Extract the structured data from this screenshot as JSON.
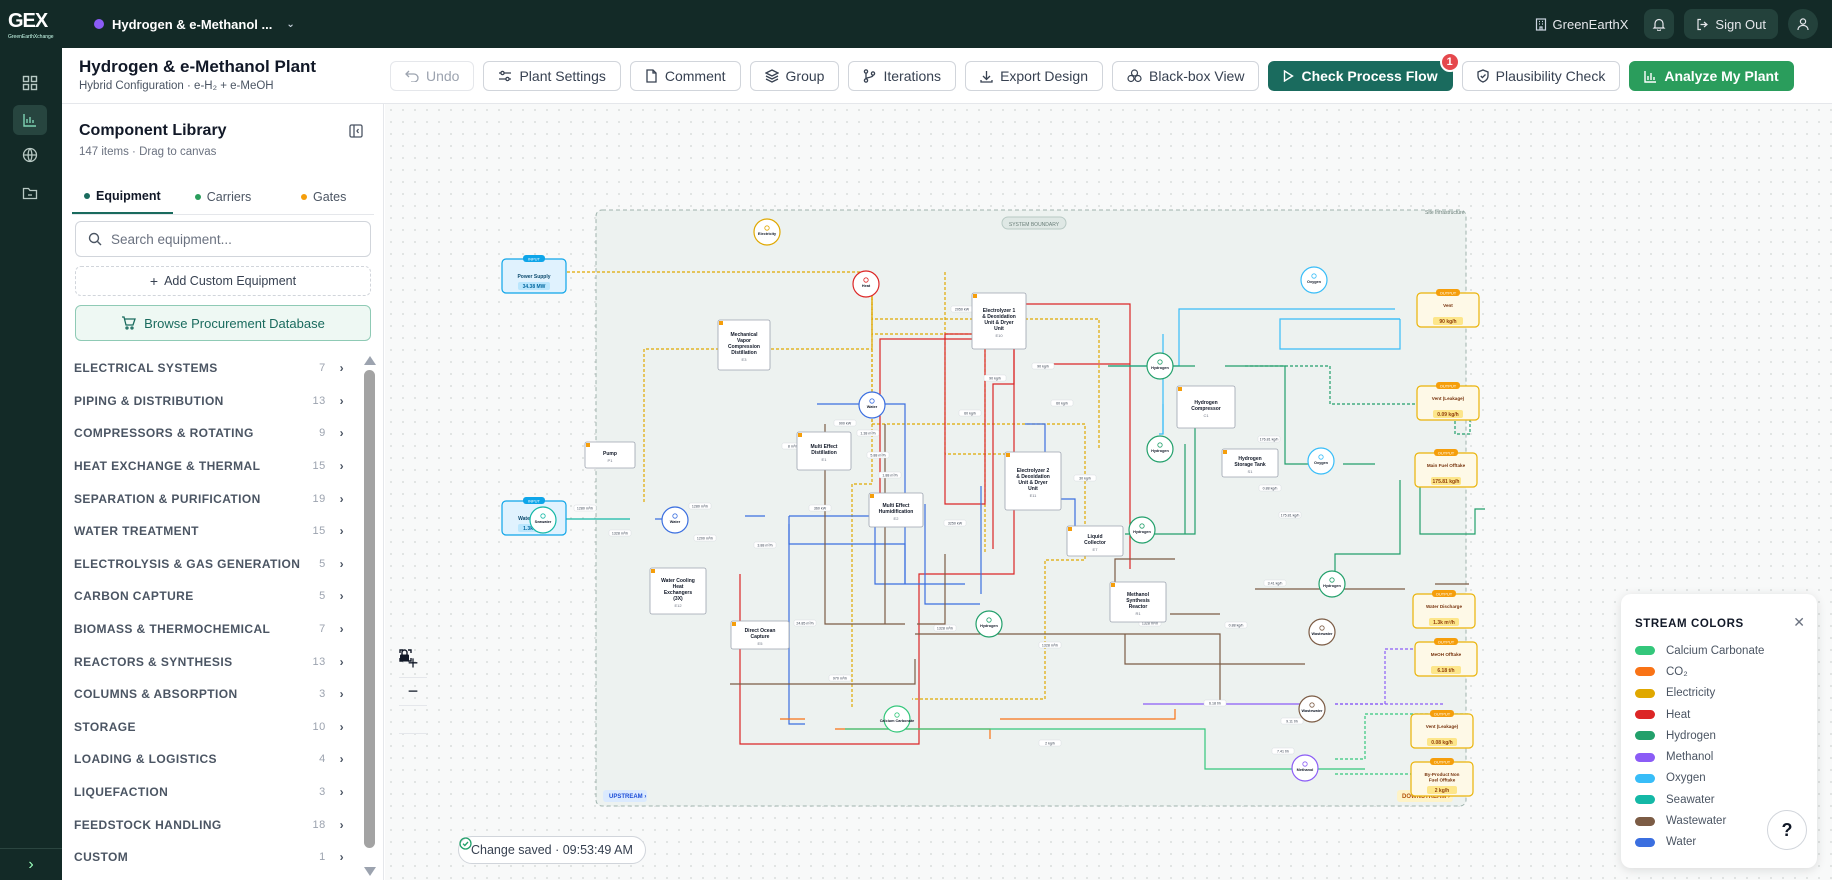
{
  "brand": {
    "logo": "GEX",
    "tagline": "GreenEarthXchange"
  },
  "topbar": {
    "project_name": "Hydrogen & e-Methanol ...",
    "project_color": "#8b5cf6",
    "org_name": "GreenEarthX",
    "sign_out": "Sign Out"
  },
  "header": {
    "title": "Hydrogen & e-Methanol Plant",
    "subtitle": "Hybrid Configuration · e-H₂ + e-MeOH"
  },
  "toolbar": {
    "undo": "Undo",
    "plant_settings": "Plant Settings",
    "comment": "Comment",
    "group": "Group",
    "iterations": "Iterations",
    "export": "Export Design",
    "blackbox": "Black-box View",
    "check_flow": "Check Process Flow",
    "check_flow_badge": "1",
    "plausibility": "Plausibility Check",
    "analyze": "Analyze My Plant"
  },
  "library": {
    "title": "Component Library",
    "subtitle": "147 items · Drag to canvas",
    "tabs": [
      {
        "label": "Equipment",
        "color": "#1a6b5e"
      },
      {
        "label": "Carriers",
        "color": "#2a9d5c"
      },
      {
        "label": "Gates",
        "color": "#f59e0b"
      }
    ],
    "search_placeholder": "Search equipment...",
    "add_custom": "Add Custom Equipment",
    "browse": "Browse Procurement Database",
    "categories": [
      {
        "name": "ELECTRICAL SYSTEMS",
        "count": "7"
      },
      {
        "name": "PIPING & DISTRIBUTION",
        "count": "13"
      },
      {
        "name": "COMPRESSORS & ROTATING",
        "count": "9"
      },
      {
        "name": "HEAT EXCHANGE & THERMAL",
        "count": "15"
      },
      {
        "name": "SEPARATION & PURIFICATION",
        "count": "19"
      },
      {
        "name": "WATER TREATMENT",
        "count": "15"
      },
      {
        "name": "ELECTROLYSIS & GAS GENERATION",
        "count": "5"
      },
      {
        "name": "CARBON CAPTURE",
        "count": "5"
      },
      {
        "name": "BIOMASS & THERMOCHEMICAL",
        "count": "7"
      },
      {
        "name": "REACTORS & SYNTHESIS",
        "count": "13"
      },
      {
        "name": "COLUMNS & ABSORPTION",
        "count": "3"
      },
      {
        "name": "STORAGE",
        "count": "10"
      },
      {
        "name": "LOADING & LOGISTICS",
        "count": "4"
      },
      {
        "name": "LIQUEFACTION",
        "count": "3"
      },
      {
        "name": "FEEDSTOCK HANDLING",
        "count": "18"
      },
      {
        "name": "CUSTOM",
        "count": "1"
      }
    ]
  },
  "canvas": {
    "boundary_label": "SYSTEM BOUNDARY",
    "site_label": "Site Infrastructure",
    "upstream": "UPSTREAM ›",
    "downstream": "DOWNSTREAM ›",
    "saved": "Change saved · 09:53:49 AM",
    "inputs": [
      {
        "tag": "INPUT",
        "name": "Power Supply",
        "value": "34.38 MW"
      },
      {
        "tag": "INPUT",
        "name": "Water Supply",
        "value": "1.3k m³/h"
      }
    ],
    "equipment": [
      {
        "name": "Pump",
        "id": "P1"
      },
      {
        "name": "Mechanical Vapor Compression Distillation",
        "id": "E3"
      },
      {
        "name": "Multi Effect Distillation",
        "id": "E1"
      },
      {
        "name": "Multi Effect Humidification",
        "id": "E2"
      },
      {
        "name": "Electrolyzer 1 & Deoxidation Unit & Dryer Unit",
        "id": "E10"
      },
      {
        "name": "Electrolyzer 2 & Deoxidation Unit & Dryer Unit",
        "id": "E11"
      },
      {
        "name": "Hydrogen Compressor",
        "id": "C1"
      },
      {
        "name": "Hydrogen Storage Tank",
        "id": "S1"
      },
      {
        "name": "Liquid Collector",
        "id": "E7"
      },
      {
        "name": "Methanol Synthesis Reactor",
        "id": "R1"
      },
      {
        "name": "Water Cooling Heat Exchangers (3X)",
        "id": "E12"
      },
      {
        "name": "Direct Ocean Capture",
        "id": "E5"
      }
    ],
    "carriers": [
      "Electricity",
      "Heat",
      "Seawater",
      "Water",
      "Water",
      "Hydrogen",
      "Oxygen",
      "Hydrogen",
      "Hydrogen",
      "Oxygen",
      "Hydrogen",
      "Hydrogen",
      "Wastewater",
      "Wastewater",
      "Methanol",
      "Calcium Carbonate",
      "CO₂"
    ],
    "outputs": [
      {
        "tag": "OUTPUT",
        "name": "Vent",
        "value": "90 kg/h"
      },
      {
        "tag": "OUTPUT",
        "name": "Vent (Leakage)",
        "value": "0.09 kg/h"
      },
      {
        "tag": "OUTPUT",
        "name": "Main Fuel Offtake",
        "value": "175.81 kg/h"
      },
      {
        "tag": "OUTPUT",
        "name": "Water Discharge",
        "value": "1.3k m³/h"
      },
      {
        "tag": "OUTPUT",
        "name": "MeOH Offtake",
        "value": "6.18 t/h"
      },
      {
        "tag": "OUTPUT",
        "name": "Vent (Leakage)",
        "value": "0.08 kg/h"
      },
      {
        "tag": "OUTPUT",
        "name": "By-Product Non Fuel Offtake",
        "value": "2 kg/h"
      }
    ],
    "flow_labels": [
      "1280 m³/h",
      "1328 m³/h",
      "1280 m³/h",
      "1200 m³/h",
      "2050 kW",
      "8 m³/h",
      "900 kW",
      "1.38 m³/h",
      "360 kW",
      "90 kg/h",
      "60 kg/h",
      "5.88 m³/h",
      "1.88 m³/h",
      "3.88 m³/h",
      "3250 kW",
      "90 kg/h",
      "60 kg/h",
      "30 kg/h",
      "176.81 kg/h",
      "175.81 kg/h",
      "0.88 kg/h",
      "3.41 kg/h",
      "0.88 kg/h",
      "1328 m³/h",
      "1328 m³/h",
      "1328 m³/h",
      "6.18 t/h",
      "7.41 t/h",
      "9.11 t/h",
      "2 kg/h",
      "970 m³/h",
      "24.85 m³/h"
    ]
  },
  "legend": {
    "title": "STREAM COLORS",
    "items": [
      {
        "label": "Calcium Carbonate",
        "color": "#34c77b"
      },
      {
        "label": "CO₂",
        "color": "#f97316"
      },
      {
        "label": "Electricity",
        "color": "#e0a800"
      },
      {
        "label": "Heat",
        "color": "#dc2626"
      },
      {
        "label": "Hydrogen",
        "color": "#22a06b"
      },
      {
        "label": "Methanol",
        "color": "#8b5cf6"
      },
      {
        "label": "Oxygen",
        "color": "#38bdf8"
      },
      {
        "label": "Seawater",
        "color": "#14b8a6"
      },
      {
        "label": "Wastewater",
        "color": "#7c5c45"
      },
      {
        "label": "Water",
        "color": "#3b6fe0"
      }
    ]
  }
}
